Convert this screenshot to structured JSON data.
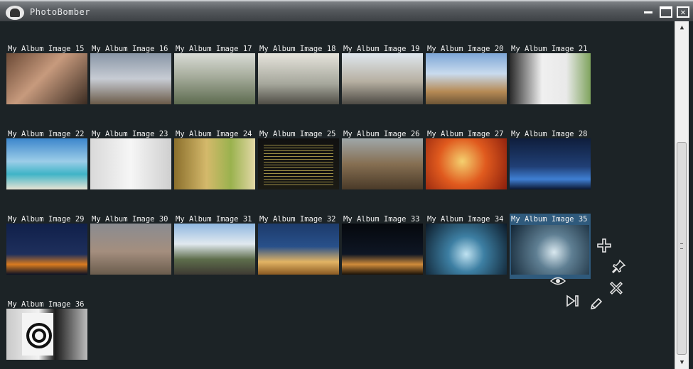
{
  "window": {
    "title": "PhotoBomber",
    "minimize_icon": "minimize-icon",
    "maximize_icon": "maximize-icon",
    "close_icon": "close-icon"
  },
  "gallery": {
    "selected_index": 20,
    "images": [
      {
        "label": "My Album Image 15",
        "thumb": "portrait-face"
      },
      {
        "label": "My Album Image 16",
        "thumb": "tower"
      },
      {
        "label": "My Album Image 17",
        "thumb": "hillside-city"
      },
      {
        "label": "My Album Image 18",
        "thumb": "statue"
      },
      {
        "label": "My Album Image 19",
        "thumb": "bridge-city"
      },
      {
        "label": "My Album Image 20",
        "thumb": "cathedral"
      },
      {
        "label": "My Album Image 21",
        "thumb": "rabbit"
      },
      {
        "label": "My Album Image 22",
        "thumb": "beach"
      },
      {
        "label": "My Album Image 23",
        "thumb": "forks"
      },
      {
        "label": "My Album Image 24",
        "thumb": "red-toy"
      },
      {
        "label": "My Album Image 25",
        "thumb": "document"
      },
      {
        "label": "My Album Image 26",
        "thumb": "ruins"
      },
      {
        "label": "My Album Image 27",
        "thumb": "person"
      },
      {
        "label": "My Album Image 28",
        "thumb": "city-night"
      },
      {
        "label": "My Album Image 29",
        "thumb": "skyline-night"
      },
      {
        "label": "My Album Image 30",
        "thumb": "dust-storm"
      },
      {
        "label": "My Album Image 31",
        "thumb": "palm-trees"
      },
      {
        "label": "My Album Image 32",
        "thumb": "basilica"
      },
      {
        "label": "My Album Image 33",
        "thumb": "city-lights"
      },
      {
        "label": "My Album Image 34",
        "thumb": "water-splash"
      },
      {
        "label": "My Album Image 35",
        "thumb": "water-splash-2"
      },
      {
        "label": "My Album Image 36",
        "thumb": "target"
      }
    ]
  },
  "actions": {
    "add_icon": "plus-icon",
    "pin_icon": "pin-icon",
    "view_icon": "eye-icon",
    "remove_icon": "x-icon",
    "next_icon": "skip-next-icon",
    "edit_icon": "pencil-icon"
  },
  "colors": {
    "background": "#1c2326",
    "selection": "#2f5a7c",
    "label_text": "#f2f2f2"
  }
}
